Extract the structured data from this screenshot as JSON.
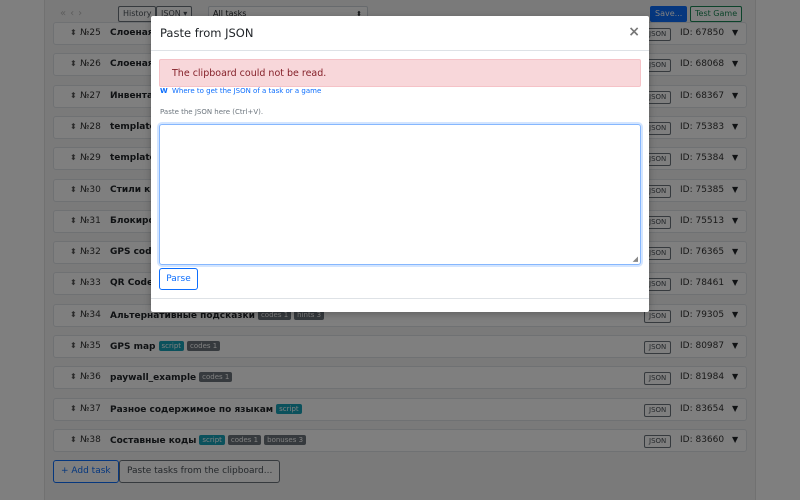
{
  "toolbar": {
    "nav_back": "«",
    "nav_prev": "‹",
    "nav_next": "›",
    "history_label": "History",
    "json_label": "JSON",
    "filter_value": "All tasks",
    "save_label": "Save...",
    "test_game_label": "Test Game"
  },
  "tasks": [
    {
      "num": "№25",
      "title": "Слоеная",
      "badges": [],
      "json": "JSON",
      "id": "ID: 67850"
    },
    {
      "num": "№26",
      "title": "Слоеная",
      "badges": [],
      "json": "JSON",
      "id": "ID: 68068"
    },
    {
      "num": "№27",
      "title": "Инвента",
      "badges": [],
      "json": "JSON",
      "id": "ID: 68367"
    },
    {
      "num": "№28",
      "title": "template",
      "badges": [],
      "json": "JSON",
      "id": "ID: 75383"
    },
    {
      "num": "№29",
      "title": "template",
      "badges": [],
      "json": "JSON",
      "id": "ID: 75384"
    },
    {
      "num": "№30",
      "title": "Стили к",
      "badges": [],
      "json": "JSON",
      "id": "ID: 75385"
    },
    {
      "num": "№31",
      "title": "Блокиро",
      "badges": [],
      "json": "JSON",
      "id": "ID: 75513"
    },
    {
      "num": "№32",
      "title": "GPS cod",
      "badges": [],
      "json": "JSON",
      "id": "ID: 76365"
    },
    {
      "num": "№33",
      "title": "QR Code",
      "badges": [],
      "json": "JSON",
      "id": "ID: 78461"
    },
    {
      "num": "№34",
      "title": "Альтернативные подсказки",
      "badges": [
        {
          "text": "codes 1",
          "kind": "gray"
        },
        {
          "text": "hints 3",
          "kind": "gray"
        }
      ],
      "json": "JSON",
      "id": "ID: 79305"
    },
    {
      "num": "№35",
      "title": "GPS map",
      "badges": [
        {
          "text": "script",
          "kind": "script"
        },
        {
          "text": "codes 1",
          "kind": "gray"
        }
      ],
      "json": "JSON",
      "id": "ID: 80987"
    },
    {
      "num": "№36",
      "title": "paywall_example",
      "badges": [
        {
          "text": "codes 1",
          "kind": "gray"
        }
      ],
      "json": "JSON",
      "id": "ID: 81984"
    },
    {
      "num": "№37",
      "title": "Разное содержимое по языкам",
      "badges": [
        {
          "text": "script",
          "kind": "script"
        }
      ],
      "json": "JSON",
      "id": "ID: 83654"
    },
    {
      "num": "№38",
      "title": "Составные коды",
      "badges": [
        {
          "text": "script",
          "kind": "script"
        },
        {
          "text": "codes 1",
          "kind": "gray"
        },
        {
          "text": "bonuses 3",
          "kind": "gray"
        }
      ],
      "json": "JSON",
      "id": "ID: 83660"
    }
  ],
  "row_handle_icon": "drag-handle-icon",
  "row_arrow_icon": "triangle-down-icon",
  "footer": {
    "add_task_label": "+ Add task",
    "paste_tasks_label": "Paste tasks from the clipboard..."
  },
  "modal": {
    "title": "Paste from JSON",
    "close_glyph": "×",
    "alert_text": "The clipboard could not be read.",
    "help_icon": "W",
    "help_link_text": "Where to get the JSON of a task or a game",
    "paste_label": "Paste the JSON here (Ctrl+V).",
    "textarea_value": "",
    "parse_label": "Parse"
  },
  "colors": {
    "primary": "#0d6efd",
    "success": "#198754",
    "alert_bg": "#f8d7da",
    "alert_text": "#842029",
    "badge_gray": "#6c757d",
    "badge_script": "#17a2b8"
  }
}
